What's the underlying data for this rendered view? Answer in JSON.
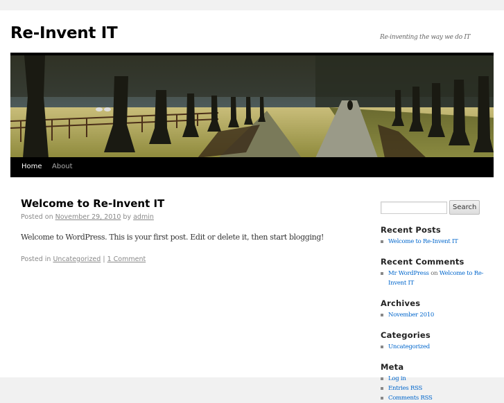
{
  "site": {
    "title": "Re-Invent IT",
    "description": "Re-inventing the way we do IT"
  },
  "nav": {
    "items": [
      {
        "label": "Home",
        "active": true
      },
      {
        "label": "About",
        "active": false
      }
    ]
  },
  "post": {
    "title": "Welcome to Re-Invent IT",
    "meta_prefix": "Posted on",
    "date": "November 29, 2010",
    "by": "by",
    "author": "admin",
    "content": "Welcome to WordPress. This is your first post. Edit or delete it, then start blogging!",
    "utility_prefix": "Posted in",
    "category": "Uncategorized",
    "separator": "|",
    "comments": "1 Comment"
  },
  "sidebar": {
    "search": {
      "value": "",
      "placeholder": "",
      "button_label": "Search"
    },
    "recent_posts": {
      "title": "Recent Posts",
      "items": [
        "Welcome to Re-Invent IT"
      ]
    },
    "recent_comments": {
      "title": "Recent Comments",
      "items": [
        {
          "author": "Mr WordPress",
          "on": "on",
          "post": "Welcome to Re-Invent IT"
        }
      ]
    },
    "archives": {
      "title": "Archives",
      "items": [
        "November 2010"
      ]
    },
    "categories": {
      "title": "Categories",
      "items": [
        "Uncategorized"
      ]
    },
    "meta": {
      "title": "Meta",
      "items": [
        "Log in",
        "Entries RSS",
        "Comments RSS"
      ]
    }
  },
  "colors": {
    "link": "#0066cc",
    "nav_bg": "#000000",
    "page_bg": "#f1f1f1"
  }
}
